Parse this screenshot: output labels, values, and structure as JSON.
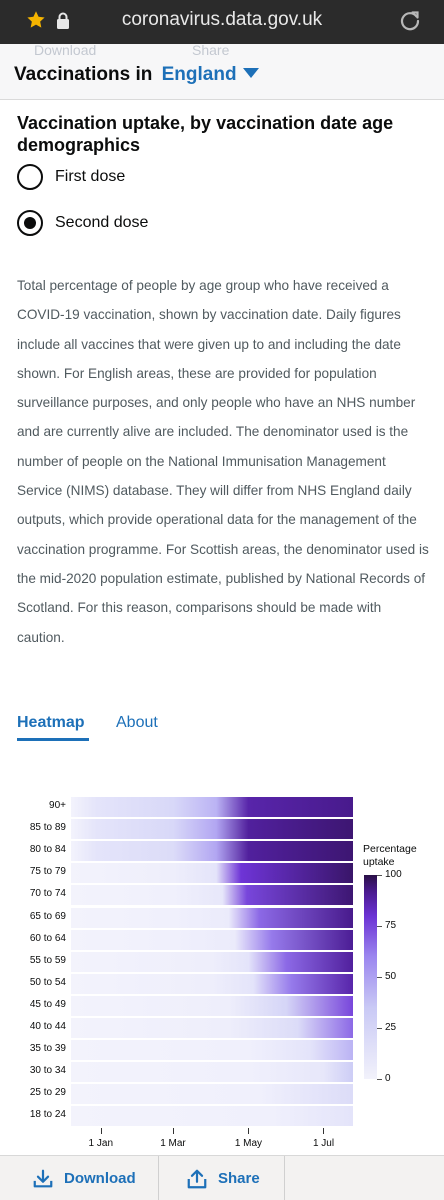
{
  "browser": {
    "url": "coronavirus.data.gov.uk",
    "icons": [
      "star-icon",
      "lock-icon",
      "reload-icon"
    ]
  },
  "header": {
    "title_prefix": "Vaccinations in",
    "area": "England",
    "ghost_download": "Download",
    "ghost_share": "Share"
  },
  "card": {
    "title": "Vaccination uptake, by vaccination date age demographics",
    "radio": [
      {
        "label": "First dose",
        "selected": false
      },
      {
        "label": "Second dose",
        "selected": true
      }
    ],
    "description": "Total percentage of people by age group who have received a COVID-19 vaccination, shown by vaccination date. Daily figures include all vaccines that were given up to and including the date shown. For English areas, these are provided for population surveillance purposes, and only people who have an NHS number and are currently alive are included. The denominator used is the number of people on the National Immunisation Management Service (NIMS) database. They will differ from NHS England daily outputs, which provide operational data for the management of the vaccination programme. For Scottish areas, the denominator used is the mid-2020 population estimate, published by National Records of Scotland. For this reason, comparisons should be made with caution.",
    "tabs": [
      {
        "label": "Heatmap",
        "active": true
      },
      {
        "label": "About",
        "active": false
      }
    ]
  },
  "chart_data": {
    "type": "heatmap",
    "rows": [
      "90+",
      "85 to 89",
      "80 to 84",
      "75 to 79",
      "70 to 74",
      "65 to 69",
      "60 to 64",
      "55 to 59",
      "50 to 54",
      "45 to 49",
      "40 to 44",
      "35 to 39",
      "30 to 34",
      "25 to 29",
      "18 to 24"
    ],
    "x_ticks": [
      "1 Jan",
      "1 Mar",
      "1 May",
      "1 Jul"
    ],
    "x_tick_dates": [
      "2021-01-01",
      "2021-03-01",
      "2021-05-01",
      "2021-07-01"
    ],
    "x_range": [
      "2020-12-08",
      "2021-07-25"
    ],
    "legend_title": "Percentage uptake",
    "legend_ticks": [
      "0",
      "25",
      "50",
      "75",
      "100"
    ],
    "scale_range": [
      0,
      100
    ],
    "series": [
      {
        "name": "90+",
        "x": [
          "2020-12-08",
          "2020-12-29",
          "2021-03-01",
          "2021-04-05",
          "2021-05-01",
          "2021-07-25"
        ],
        "values": [
          0,
          10,
          18,
          35,
          85,
          92
        ]
      },
      {
        "name": "85 to 89",
        "x": [
          "2020-12-08",
          "2020-12-29",
          "2021-03-01",
          "2021-04-05",
          "2021-05-01",
          "2021-07-25"
        ],
        "values": [
          0,
          10,
          18,
          40,
          88,
          95
        ]
      },
      {
        "name": "80 to 84",
        "x": [
          "2020-12-08",
          "2020-12-29",
          "2021-03-01",
          "2021-04-05",
          "2021-05-01",
          "2021-07-25"
        ],
        "values": [
          0,
          10,
          15,
          40,
          88,
          95
        ]
      },
      {
        "name": "75 to 79",
        "x": [
          "2020-12-08",
          "2021-03-01",
          "2021-04-05",
          "2021-04-25",
          "2021-07-25"
        ],
        "values": [
          0,
          3,
          10,
          75,
          96
        ]
      },
      {
        "name": "70 to 74",
        "x": [
          "2020-12-08",
          "2021-03-01",
          "2021-04-10",
          "2021-04-30",
          "2021-07-25"
        ],
        "values": [
          0,
          2,
          8,
          70,
          95
        ]
      },
      {
        "name": "65 to 69",
        "x": [
          "2020-12-08",
          "2021-03-01",
          "2021-04-15",
          "2021-05-10",
          "2021-07-25"
        ],
        "values": [
          0,
          2,
          5,
          60,
          92
        ]
      },
      {
        "name": "60 to 64",
        "x": [
          "2020-12-08",
          "2021-03-01",
          "2021-04-20",
          "2021-05-20",
          "2021-07-25"
        ],
        "values": [
          0,
          2,
          5,
          55,
          90
        ]
      },
      {
        "name": "55 to 59",
        "x": [
          "2020-12-08",
          "2021-04-01",
          "2021-05-01",
          "2021-06-01",
          "2021-07-25"
        ],
        "values": [
          0,
          3,
          10,
          60,
          88
        ]
      },
      {
        "name": "50 to 54",
        "x": [
          "2020-12-08",
          "2021-04-01",
          "2021-05-05",
          "2021-06-05",
          "2021-07-25"
        ],
        "values": [
          0,
          3,
          10,
          55,
          85
        ]
      },
      {
        "name": "45 to 49",
        "x": [
          "2020-12-08",
          "2021-04-15",
          "2021-06-01",
          "2021-07-25"
        ],
        "values": [
          0,
          3,
          20,
          70
        ]
      },
      {
        "name": "40 to 44",
        "x": [
          "2020-12-08",
          "2021-04-15",
          "2021-06-10",
          "2021-07-25"
        ],
        "values": [
          0,
          3,
          15,
          60
        ]
      },
      {
        "name": "35 to 39",
        "x": [
          "2020-12-08",
          "2021-05-01",
          "2021-06-20",
          "2021-07-25"
        ],
        "values": [
          0,
          2,
          10,
          35
        ]
      },
      {
        "name": "30 to 34",
        "x": [
          "2020-12-08",
          "2021-05-01",
          "2021-07-01",
          "2021-07-25"
        ],
        "values": [
          0,
          2,
          8,
          25
        ]
      },
      {
        "name": "25 to 29",
        "x": [
          "2020-12-08",
          "2021-05-10",
          "2021-07-25"
        ],
        "values": [
          0,
          2,
          15
        ]
      },
      {
        "name": "18 to 24",
        "x": [
          "2020-12-08",
          "2021-05-20",
          "2021-07-25"
        ],
        "values": [
          0,
          2,
          10
        ]
      }
    ]
  },
  "footer": {
    "download_label": "Download",
    "share_label": "Share"
  }
}
